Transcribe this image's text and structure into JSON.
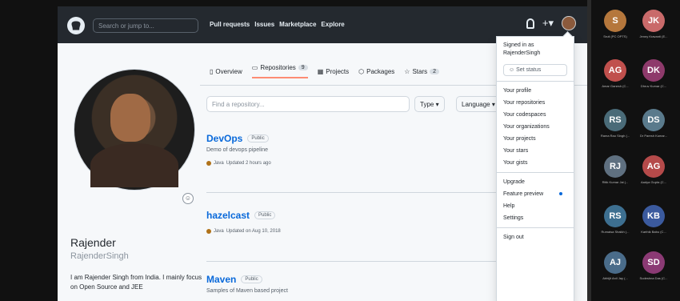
{
  "github": {
    "search_placeholder": "Search or jump to...",
    "nav": [
      "Pull requests",
      "Issues",
      "Marketplace",
      "Explore"
    ],
    "plus_label": "+▾",
    "tabs": [
      {
        "label": "Overview",
        "icon": "book-icon"
      },
      {
        "label": "Repositories",
        "count": "9",
        "icon": "repo-icon"
      },
      {
        "label": "Projects",
        "icon": "project-icon"
      },
      {
        "label": "Packages",
        "icon": "package-icon"
      },
      {
        "label": "Stars",
        "count": "2",
        "icon": "star-icon"
      }
    ],
    "repo_search_placeholder": "Find a repository...",
    "type_btn": "Type ▾",
    "language_btn": "Language ▾",
    "profile": {
      "name": "Rajender",
      "username": "RajenderSingh",
      "bio": "I am Rajender Singh from India. I mainly focus on Open Source and JEE"
    },
    "repos": [
      {
        "name": "DevOps",
        "badge": "Public",
        "desc": "Demo of devops pipeline",
        "lang": "Java",
        "updated": "Updated 2 hours ago"
      },
      {
        "name": "hazelcast",
        "badge": "Public",
        "desc": "",
        "lang": "Java",
        "updated": "Updated on Aug 10, 2018"
      },
      {
        "name": "Maven",
        "badge": "Public",
        "desc": "Samples of Maven based project",
        "lang": "",
        "updated": ""
      }
    ],
    "dropdown": {
      "signed_in_as": "Signed in as",
      "user": "RajenderSingh",
      "status": "☺ Set status",
      "items1": [
        "Your profile",
        "Your repositories",
        "Your codespaces",
        "Your organizations",
        "Your projects",
        "Your stars",
        "Your gists"
      ],
      "items2": [
        "Upgrade",
        "Feature preview",
        "Help",
        "Settings"
      ],
      "signout": "Sign out"
    }
  },
  "participants": [
    {
      "initials": "S",
      "color": "#b5773c",
      "caption": "Sruti (PC OPTS)"
    },
    {
      "initials": "JK",
      "color": "#c96a6a",
      "caption": "Jenny Kravanti (E..."
    },
    {
      "initials": "AG",
      "color": "#c0504d",
      "caption": "Amar Ganesh (C..."
    },
    {
      "initials": "DK",
      "color": "#8e3a6b",
      "caption": "Dhruv Kumar (C..."
    },
    {
      "initials": "RS",
      "color": "#4a6b78",
      "caption": "Rama Rao Singh (..."
    },
    {
      "initials": "DS",
      "color": "#5a7a8c",
      "caption": "Dr Paresh Kumar..."
    },
    {
      "initials": "RJ",
      "color": "#5f7080",
      "caption": "Ritik Kumar Jai (..."
    },
    {
      "initials": "AG",
      "color": "#b54a4a",
      "caption": "Aadya Gupta (C..."
    },
    {
      "initials": "RS",
      "color": "#3d6f90",
      "caption": "Rumaisa Shaikh (..."
    },
    {
      "initials": "KB",
      "color": "#3b5a9e",
      "caption": "Karthik Babu (C..."
    },
    {
      "initials": "AJ",
      "color": "#4a6c8a",
      "caption": "Abhijit Anil Jay (..."
    },
    {
      "initials": "SD",
      "color": "#8b3a74",
      "caption": "Sudeshna Das (C..."
    }
  ]
}
